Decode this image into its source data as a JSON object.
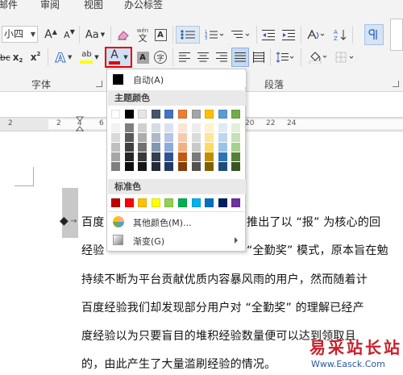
{
  "ribbon": {
    "tabs": [
      "邮件",
      "审阅",
      "视图",
      "办公标签"
    ],
    "font_size_value": "小四",
    "grow_font": "A",
    "shrink_font": "A",
    "change_case": "Aa",
    "phonetic_guide": "文",
    "char_border": "A",
    "strikethrough": "abc",
    "subscript": "x",
    "superscript": "x",
    "text_effects": "A",
    "highlight": "ab",
    "font_color": "A",
    "char_shading": "A",
    "enclose_char": "字",
    "font_group_label": "字体",
    "paragraph_group_label": "段落"
  },
  "ruler": {
    "numbers": [
      "2",
      "2",
      "4",
      "6",
      "8",
      "10",
      "12",
      "14",
      "16",
      "18",
      "20",
      "22",
      "24"
    ]
  },
  "dropdown": {
    "automatic_label": "自动(A)",
    "theme_colors_label": "主题颜色",
    "standard_colors_label": "标准色",
    "more_colors_label": "其他颜色(M)...",
    "gradient_label": "渐变(G)",
    "theme_colors": [
      "#ffffff",
      "#000000",
      "#e7e6e6",
      "#44546a",
      "#4472c4",
      "#ed7d31",
      "#a5a5a5",
      "#ffc000",
      "#5b9bd5",
      "#70ad47"
    ],
    "theme_shades": [
      [
        "#f2f2f2",
        "#d9d9d9",
        "#bfbfbf",
        "#a6a6a6",
        "#7f7f7f"
      ],
      [
        "#7f7f7f",
        "#595959",
        "#404040",
        "#262626",
        "#0d0d0d"
      ],
      [
        "#d0cece",
        "#aeabab",
        "#757171",
        "#3a3838",
        "#171616"
      ],
      [
        "#d6dce4",
        "#adb9ca",
        "#8496b0",
        "#333f4f",
        "#222a35"
      ],
      [
        "#d9e2f3",
        "#b4c6e7",
        "#8eaadb",
        "#2f5496",
        "#1f3864"
      ],
      [
        "#fbe5d5",
        "#f7caac",
        "#f4b083",
        "#c45911",
        "#833c0b"
      ],
      [
        "#ededed",
        "#dbdbdb",
        "#c9c9c9",
        "#7b7b7b",
        "#525252"
      ],
      [
        "#fff2cc",
        "#fee599",
        "#ffd965",
        "#bf8f00",
        "#7f6000"
      ],
      [
        "#deebf6",
        "#bdd7ee",
        "#9cc3e5",
        "#2e75b5",
        "#1e4e79"
      ],
      [
        "#e2efd9",
        "#c5e0b3",
        "#a8d08d",
        "#538135",
        "#375623"
      ]
    ],
    "standard_colors": [
      "#c00000",
      "#ff0000",
      "#ffc000",
      "#ffff00",
      "#92d050",
      "#00b050",
      "#00b0f0",
      "#0070c0",
      "#002060",
      "#7030a0"
    ]
  },
  "document": {
    "lines": [
      "百度",
      "经验",
      "持续不断为平台贡献优质内容暴风雨的用户，然而随着计",
      "百度经验我们却发现部分用户对 “全勤奖” 的理解已经产",
      "度经验以为只要盲目的堆积经验数量便可以达到领取且",
      "的，由此产生了大量滥刷经验的情况。"
    ],
    "line1_tail": "推出了以 “报” 为核心的回",
    "line2_tail": "“全勤奖” 模式，原本旨在勉"
  },
  "watermark": {
    "title": "易采站长站",
    "url": "Www.Easck.Com"
  }
}
